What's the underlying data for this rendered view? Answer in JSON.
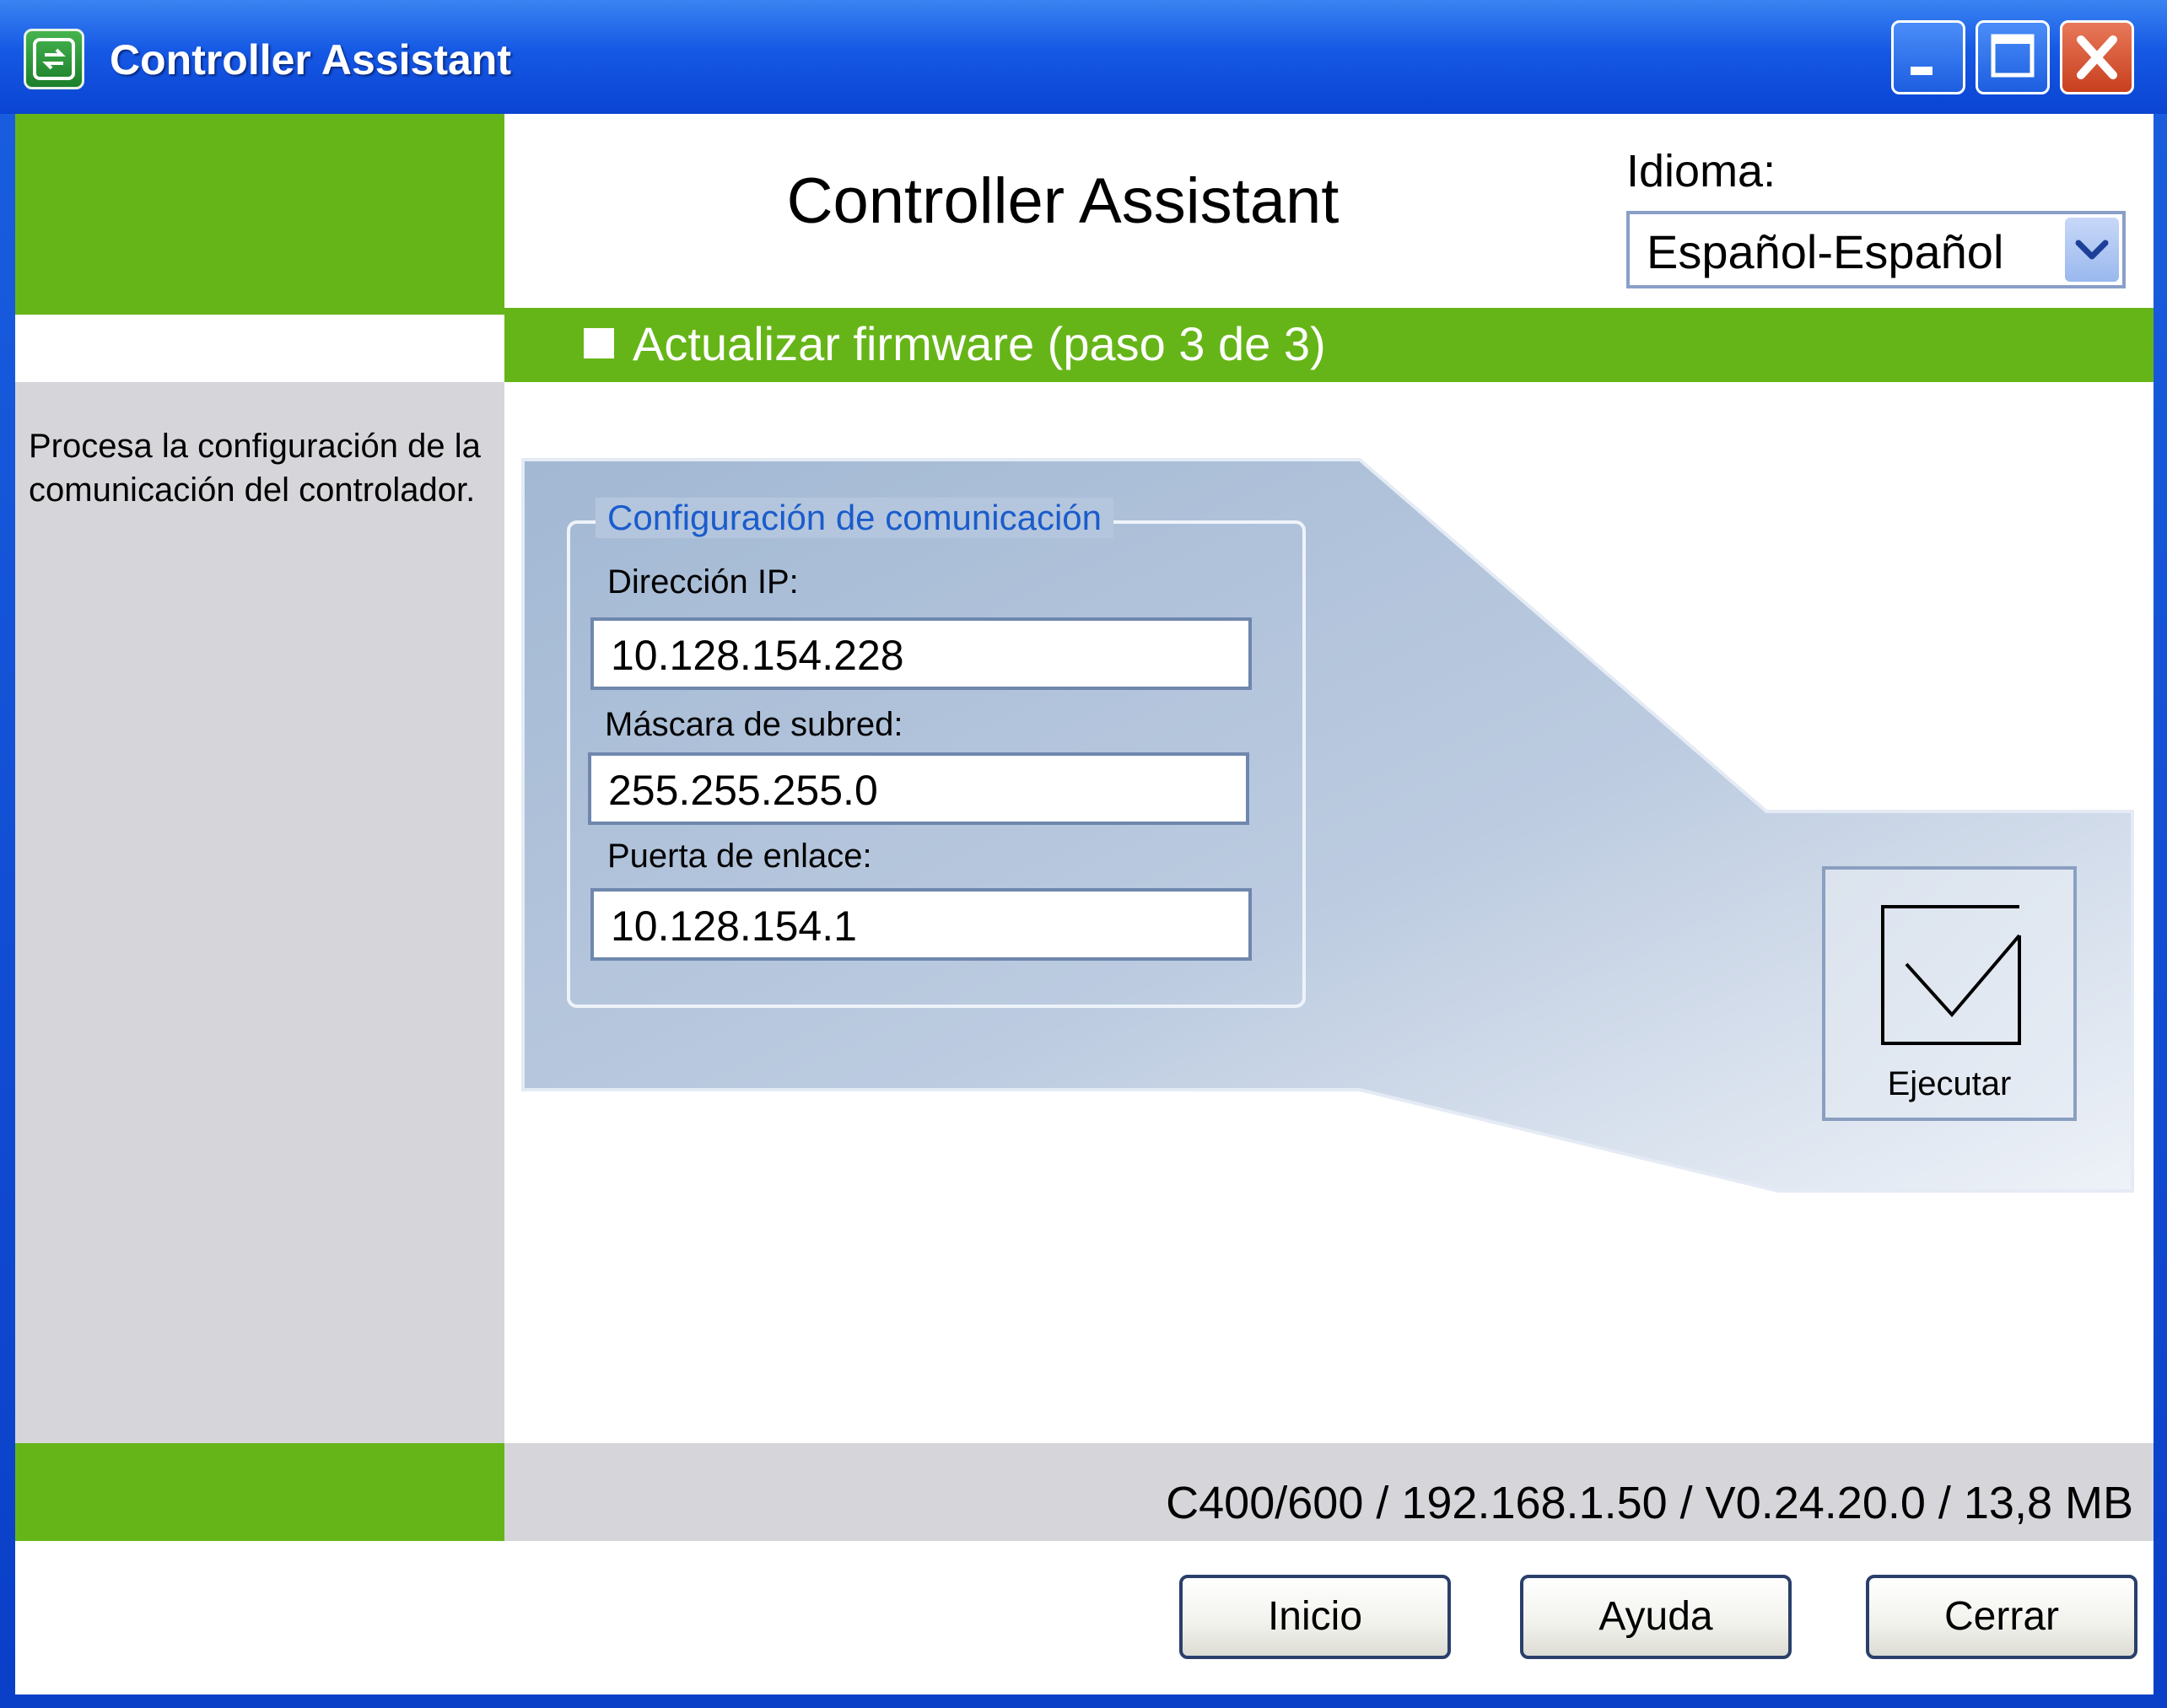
{
  "window": {
    "title": "Controller Assistant",
    "controls": {
      "minimize": "minimize",
      "maximize": "maximize",
      "close": "close"
    }
  },
  "header": {
    "app_title": "Controller Assistant",
    "language_label": "Idioma:",
    "language_value": "Español-Español"
  },
  "step": {
    "label": "Actualizar firmware (paso 3 de 3)"
  },
  "sidebar": {
    "description": "Procesa la configuración de la comunicación del controlador."
  },
  "communication": {
    "group_title": "Configuración de comunicación",
    "ip_label": "Dirección IP:",
    "ip_value": "10.128.154.228",
    "subnet_label": "Máscara de subred:",
    "subnet_value": "255.255.255.0",
    "gateway_label": "Puerta de enlace:",
    "gateway_value": "10.128.154.1"
  },
  "execute": {
    "label": "Ejecutar"
  },
  "status": {
    "text": "C400/600 / 192.168.1.50 / V0.24.20.0 / 13,8 MB"
  },
  "footer": {
    "inicio": "Inicio",
    "ayuda": "Ayuda",
    "cerrar": "Cerrar"
  },
  "colors": {
    "accent_green": "#66b518",
    "title_blue": "#1558e4",
    "panel_blue": "#a9bdd7",
    "group_title_blue": "#1a5ccc"
  },
  "icons": {
    "app": "controller-app-icon",
    "minimize": "minimize-icon",
    "maximize": "maximize-icon",
    "close": "close-icon",
    "dropdown": "chevron-down-icon",
    "execute": "checkbox-check-icon"
  }
}
